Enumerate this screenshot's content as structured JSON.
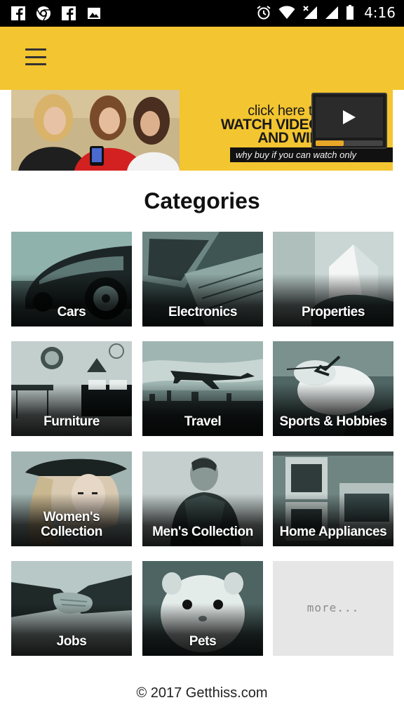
{
  "status_bar": {
    "left_icons": [
      "facebook-icon",
      "chrome-icon",
      "facebook-icon",
      "image-icon"
    ],
    "right_icons": [
      "alarm-icon",
      "wifi-icon",
      "signal-icon",
      "battery-icon"
    ],
    "time": "4:16"
  },
  "app_bar": {
    "background": "#f3c530"
  },
  "banner": {
    "line1": "click here to",
    "line2": "WATCH VIDEO",
    "line3": "AND WIN",
    "tagline": "why buy if you can watch only"
  },
  "heading": "Categories",
  "categories": [
    {
      "label": "Cars"
    },
    {
      "label": "Electronics"
    },
    {
      "label": "Properties"
    },
    {
      "label": "Furniture"
    },
    {
      "label": "Travel"
    },
    {
      "label": "Sports & Hobbies"
    },
    {
      "label": "Women's Collection"
    },
    {
      "label": "Men's Collection"
    },
    {
      "label": "Home Appliances"
    },
    {
      "label": "Jobs"
    },
    {
      "label": "Pets"
    },
    {
      "label": "more..."
    }
  ],
  "footer": "© 2017 Getthiss.com"
}
